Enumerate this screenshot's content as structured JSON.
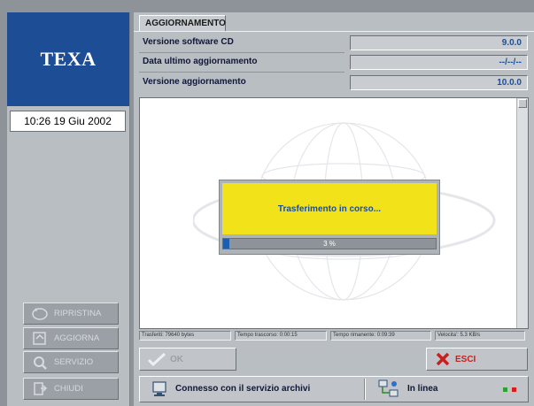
{
  "sidebar": {
    "logo": "TEXA",
    "clock": "10:26  19 Giu 2002",
    "buttons": [
      {
        "label": "RIPRISTINA",
        "icon": "restore-icon"
      },
      {
        "label": "AGGIORNA",
        "icon": "update-icon"
      },
      {
        "label": "SERVIZIO",
        "icon": "service-icon"
      },
      {
        "label": "CHIUDI",
        "icon": "close-icon"
      }
    ]
  },
  "tab": {
    "label": "AGGIORNAMENTO"
  },
  "info": [
    {
      "label": "Versione software CD",
      "value": "9.0.0"
    },
    {
      "label": "Data ultimo aggiornamento",
      "value": "--/--/--"
    },
    {
      "label": "Versione aggiornamento",
      "value": "10.0.0"
    }
  ],
  "dialog": {
    "message": "Trasferimento in corso...",
    "progress_percent": 3,
    "progress_text": "3 %"
  },
  "status": {
    "transferred": "Trasferiti: 79640 bytes",
    "elapsed": "Tempo trascorso: 0:00:15",
    "remaining": "Tempo rimanente: 0:09:39",
    "speed": "Velocita': 5.3 KB/s"
  },
  "actions": {
    "ok_label": "OK",
    "exit_label": "ESCI"
  },
  "bottom": {
    "connection": "Connesso con il servizio archivi",
    "line_status": "In linea"
  },
  "colors": {
    "brand_blue": "#1c4d95",
    "dialog_yellow": "#f2e21a",
    "exit_red": "#c8201e"
  }
}
